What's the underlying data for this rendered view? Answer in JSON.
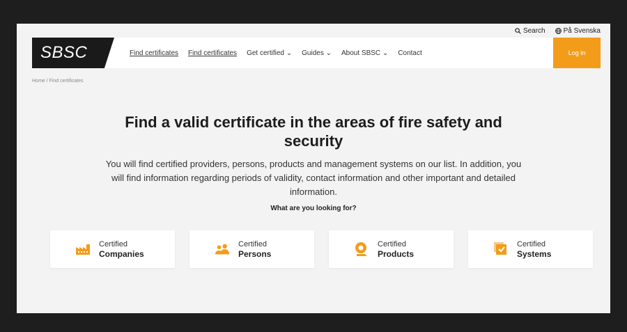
{
  "utility": {
    "search_label": "Search",
    "language_label": "På Svenska"
  },
  "nav": {
    "logo": "SBSC",
    "links": [
      "Find certificates",
      "Find certificates",
      "Get certified ⌄",
      "Guides ⌄",
      "About SBSC ⌄",
      "Contact"
    ],
    "login_label": "Log in"
  },
  "breadcrumb": "Home / Find certificates",
  "hero": {
    "title": "Find a valid certificate in the areas of fire safety and security",
    "description": "You will find certified providers, persons, products and management systems on our list. In addition, you will find information regarding periods of validity, contact information and other important and detailed information.",
    "question": "What are you looking for?"
  },
  "cards": [
    {
      "line1": "Certified",
      "line2": "Companies",
      "icon": "factory-icon"
    },
    {
      "line1": "Certified",
      "line2": "Persons",
      "icon": "persons-icon"
    },
    {
      "line1": "Certified",
      "line2": "Products",
      "icon": "fire-alarm-icon"
    },
    {
      "line1": "Certified",
      "line2": "Systems",
      "icon": "checked-documents-icon"
    }
  ],
  "colors": {
    "accent": "#f39c1a",
    "logo_bg": "#1a1a1a",
    "page_bg": "#f3f3f3"
  }
}
